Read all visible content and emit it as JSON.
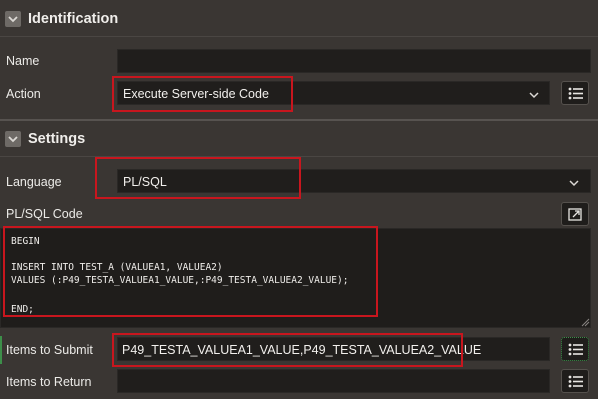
{
  "identification": {
    "title": "Identification",
    "name_label": "Name",
    "name_value": "",
    "action_label": "Action",
    "action_value": "Execute Server-side Code"
  },
  "settings": {
    "title": "Settings",
    "language_label": "Language",
    "language_value": "PL/SQL",
    "code_label": "PL/SQL Code",
    "code_lines": [
      "BEGIN",
      "",
      "INSERT INTO TEST_A (VALUEA1, VALUEA2)",
      "VALUES (:P49_TESTA_VALUEA1_VALUE,:P49_TESTA_VALUEA2_VALUE);",
      "",
      "END;"
    ],
    "items_submit_label": "Items to Submit",
    "items_submit_value": "P49_TESTA_VALUEA1_VALUE,P49_TESTA_VALUEA2_VALUE",
    "items_return_label": "Items to Return",
    "items_return_value": ""
  },
  "icons": {
    "collapse": "chevron-down-icon",
    "list": "list-icon",
    "expand": "expand-icon",
    "dropdown": "chevron-down-icon"
  },
  "colors": {
    "background": "#3a3633",
    "field": "#201e1c",
    "highlight": "#c8161e",
    "text": "#e8e6e3"
  }
}
